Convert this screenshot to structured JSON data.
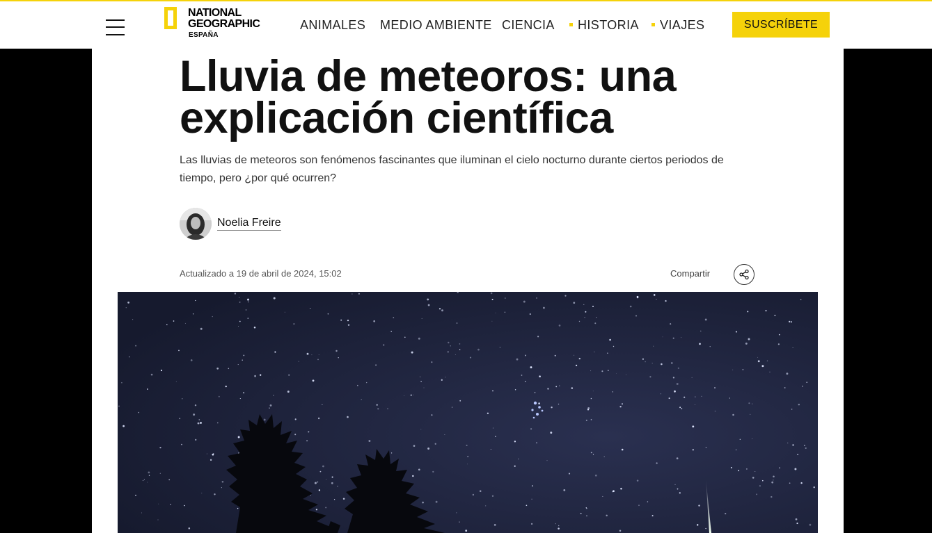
{
  "header": {
    "logo": {
      "line1": "NATIONAL",
      "line2": "GEOGRAPHIC",
      "line3": "ESPAÑA"
    },
    "nav": [
      {
        "label": "ANIMALES",
        "dot": false
      },
      {
        "label": "MEDIO AMBIENTE",
        "dot": false
      },
      {
        "label": "CIENCIA",
        "dot": false
      },
      {
        "label": "HISTORIA",
        "dot": true
      },
      {
        "label": "VIAJES",
        "dot": true
      }
    ],
    "subscribe_label": "SUSCRÍBETE"
  },
  "article": {
    "title": "Lluvia de meteoros: una explicación científica",
    "subtitle": "Las lluvias de meteoros son fenómenos fascinantes que iluminan el cielo nocturno durante ciertos periodos de tiempo, pero ¿por qué ocurren?",
    "author": "Noelia Freire",
    "updated": "Actualizado a 19 de abril de 2024, 15:02",
    "share_label": "Compartir"
  },
  "colors": {
    "accent": "#f5d20a",
    "sky": "#1c2138"
  },
  "icons": {
    "menu": "hamburger-icon",
    "share": "share-icon"
  }
}
